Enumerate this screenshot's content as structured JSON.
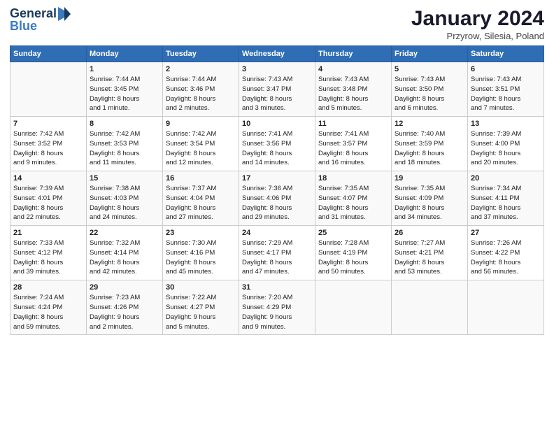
{
  "logo": {
    "line1": "General",
    "line2": "Blue"
  },
  "title": "January 2024",
  "subtitle": "Przyrow, Silesia, Poland",
  "days_of_week": [
    "Sunday",
    "Monday",
    "Tuesday",
    "Wednesday",
    "Thursday",
    "Friday",
    "Saturday"
  ],
  "weeks": [
    [
      {
        "day": "",
        "content": ""
      },
      {
        "day": "1",
        "content": "Sunrise: 7:44 AM\nSunset: 3:45 PM\nDaylight: 8 hours\nand 1 minute."
      },
      {
        "day": "2",
        "content": "Sunrise: 7:44 AM\nSunset: 3:46 PM\nDaylight: 8 hours\nand 2 minutes."
      },
      {
        "day": "3",
        "content": "Sunrise: 7:43 AM\nSunset: 3:47 PM\nDaylight: 8 hours\nand 3 minutes."
      },
      {
        "day": "4",
        "content": "Sunrise: 7:43 AM\nSunset: 3:48 PM\nDaylight: 8 hours\nand 5 minutes."
      },
      {
        "day": "5",
        "content": "Sunrise: 7:43 AM\nSunset: 3:50 PM\nDaylight: 8 hours\nand 6 minutes."
      },
      {
        "day": "6",
        "content": "Sunrise: 7:43 AM\nSunset: 3:51 PM\nDaylight: 8 hours\nand 7 minutes."
      }
    ],
    [
      {
        "day": "7",
        "content": "Sunrise: 7:42 AM\nSunset: 3:52 PM\nDaylight: 8 hours\nand 9 minutes."
      },
      {
        "day": "8",
        "content": "Sunrise: 7:42 AM\nSunset: 3:53 PM\nDaylight: 8 hours\nand 11 minutes."
      },
      {
        "day": "9",
        "content": "Sunrise: 7:42 AM\nSunset: 3:54 PM\nDaylight: 8 hours\nand 12 minutes."
      },
      {
        "day": "10",
        "content": "Sunrise: 7:41 AM\nSunset: 3:56 PM\nDaylight: 8 hours\nand 14 minutes."
      },
      {
        "day": "11",
        "content": "Sunrise: 7:41 AM\nSunset: 3:57 PM\nDaylight: 8 hours\nand 16 minutes."
      },
      {
        "day": "12",
        "content": "Sunrise: 7:40 AM\nSunset: 3:59 PM\nDaylight: 8 hours\nand 18 minutes."
      },
      {
        "day": "13",
        "content": "Sunrise: 7:39 AM\nSunset: 4:00 PM\nDaylight: 8 hours\nand 20 minutes."
      }
    ],
    [
      {
        "day": "14",
        "content": "Sunrise: 7:39 AM\nSunset: 4:01 PM\nDaylight: 8 hours\nand 22 minutes."
      },
      {
        "day": "15",
        "content": "Sunrise: 7:38 AM\nSunset: 4:03 PM\nDaylight: 8 hours\nand 24 minutes."
      },
      {
        "day": "16",
        "content": "Sunrise: 7:37 AM\nSunset: 4:04 PM\nDaylight: 8 hours\nand 27 minutes."
      },
      {
        "day": "17",
        "content": "Sunrise: 7:36 AM\nSunset: 4:06 PM\nDaylight: 8 hours\nand 29 minutes."
      },
      {
        "day": "18",
        "content": "Sunrise: 7:35 AM\nSunset: 4:07 PM\nDaylight: 8 hours\nand 31 minutes."
      },
      {
        "day": "19",
        "content": "Sunrise: 7:35 AM\nSunset: 4:09 PM\nDaylight: 8 hours\nand 34 minutes."
      },
      {
        "day": "20",
        "content": "Sunrise: 7:34 AM\nSunset: 4:11 PM\nDaylight: 8 hours\nand 37 minutes."
      }
    ],
    [
      {
        "day": "21",
        "content": "Sunrise: 7:33 AM\nSunset: 4:12 PM\nDaylight: 8 hours\nand 39 minutes."
      },
      {
        "day": "22",
        "content": "Sunrise: 7:32 AM\nSunset: 4:14 PM\nDaylight: 8 hours\nand 42 minutes."
      },
      {
        "day": "23",
        "content": "Sunrise: 7:30 AM\nSunset: 4:16 PM\nDaylight: 8 hours\nand 45 minutes."
      },
      {
        "day": "24",
        "content": "Sunrise: 7:29 AM\nSunset: 4:17 PM\nDaylight: 8 hours\nand 47 minutes."
      },
      {
        "day": "25",
        "content": "Sunrise: 7:28 AM\nSunset: 4:19 PM\nDaylight: 8 hours\nand 50 minutes."
      },
      {
        "day": "26",
        "content": "Sunrise: 7:27 AM\nSunset: 4:21 PM\nDaylight: 8 hours\nand 53 minutes."
      },
      {
        "day": "27",
        "content": "Sunrise: 7:26 AM\nSunset: 4:22 PM\nDaylight: 8 hours\nand 56 minutes."
      }
    ],
    [
      {
        "day": "28",
        "content": "Sunrise: 7:24 AM\nSunset: 4:24 PM\nDaylight: 8 hours\nand 59 minutes."
      },
      {
        "day": "29",
        "content": "Sunrise: 7:23 AM\nSunset: 4:26 PM\nDaylight: 9 hours\nand 2 minutes."
      },
      {
        "day": "30",
        "content": "Sunrise: 7:22 AM\nSunset: 4:27 PM\nDaylight: 9 hours\nand 5 minutes."
      },
      {
        "day": "31",
        "content": "Sunrise: 7:20 AM\nSunset: 4:29 PM\nDaylight: 9 hours\nand 9 minutes."
      },
      {
        "day": "",
        "content": ""
      },
      {
        "day": "",
        "content": ""
      },
      {
        "day": "",
        "content": ""
      }
    ]
  ]
}
